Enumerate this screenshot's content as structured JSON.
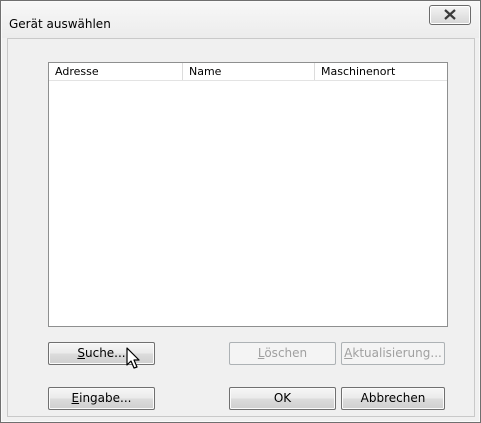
{
  "window": {
    "title": "Gerät auswählen",
    "close_icon": "close-icon"
  },
  "list": {
    "columns": [
      "Adresse",
      "Name",
      "Maschinenort"
    ],
    "rows": []
  },
  "buttons": {
    "search": {
      "accel": "S",
      "rest": "uche..."
    },
    "delete": {
      "accel": "L",
      "rest": "öschen"
    },
    "update": {
      "accel": "A",
      "rest": "ktualisierung..."
    },
    "entry": {
      "accel": "E",
      "rest": "ingabe..."
    },
    "ok": "OK",
    "cancel": "Abbrechen"
  }
}
